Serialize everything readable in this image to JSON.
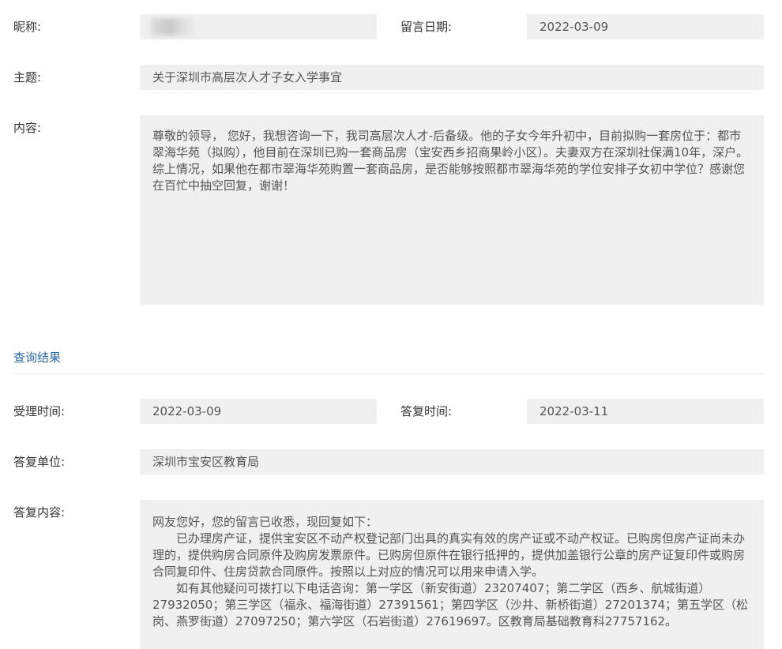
{
  "message": {
    "nickname_label": "昵称:",
    "date_label": "留言日期:",
    "date_value": "2022-03-09",
    "subject_label": "主题:",
    "subject_value": "关于深圳市高层次人才子女入学事宜",
    "content_label": "内容:",
    "content_value": "尊敬的领导， 您好，我想咨询一下，我司高层次人才-后备级。他的子女今年升初中，目前拟购一套房位于：都市翠海华苑（拟购），他目前在深圳已购一套商品房（宝安西乡招商果岭小区）。夫妻双方在深圳社保满10年，深户。综上情况，如果他在都市翠海华苑购置一套商品房，是否能够按照都市翠海华苑的学位安排子女初中学位？感谢您在百忙中抽空回复，谢谢！"
  },
  "result": {
    "section_title": "查询结果",
    "accept_time_label": "受理时间:",
    "accept_time_value": "2022-03-09",
    "reply_time_label": "答复时间:",
    "reply_time_value": "2022-03-11",
    "reply_unit_label": "答复单位:",
    "reply_unit_value": "深圳市宝安区教育局",
    "reply_content_label": "答复内容:",
    "reply_paragraphs": [
      "网友您好，您的留言已收悉，现回复如下：",
      "已办理房产证，提供宝安区不动产权登记部门出具的真实有效的房产证或不动产权证。已购房但房产证尚未办理的，提供购房合同原件及购房发票原件。已购房但原件在银行抵押的，提供加盖银行公章的房产证复印件或购房合同复印件、住房贷款合同原件。按照以上对应的情况可以用来申请入学。",
      "如有其他疑问可拨打以下电话咨询：第一学区（新安街道）23207407；第二学区（西乡、航城街道）27932050；第三学区（福永、福海街道）27391561；第四学区（沙井、新桥街道）27201374；第五学区（松岗、燕罗街道）27097250；第六学区（石岩街道）27619697。区教育局基础教育科27757162。"
    ]
  }
}
